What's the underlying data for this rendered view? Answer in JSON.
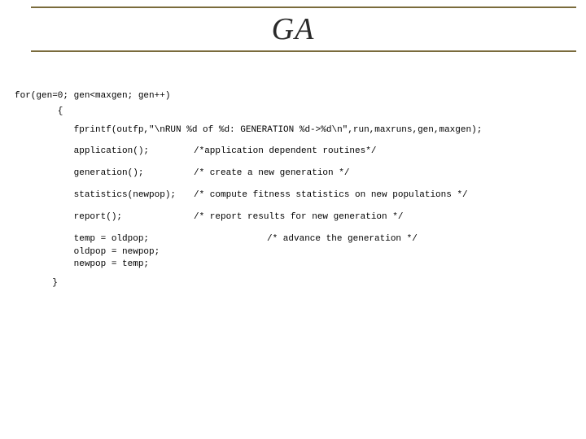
{
  "title": "GA",
  "code": {
    "for": "for(gen=0; gen<maxgen; gen++)",
    "open": "        {",
    "fprintf": "           fprintf(outfp,\"\\nRUN %d of %d: GENERATION %d->%d\\n\",run,maxruns,gen,maxgen);",
    "app_call": "           application();",
    "app_cmt": "/*application dependent routines*/",
    "gen_call": "           generation();",
    "gen_cmt": "/* create a new generation */",
    "stat_call": "           statistics(newpop);",
    "stat_cmt": "/* compute fitness statistics on new populations */",
    "rep_call": "           report();",
    "rep_cmt": "/* report results for new generation */",
    "adv1": "           temp = oldpop;",
    "adv_cmt": "/* advance the generation */",
    "adv2": "           oldpop = newpop;",
    "adv3": "           newpop = temp;",
    "close": "       }"
  }
}
